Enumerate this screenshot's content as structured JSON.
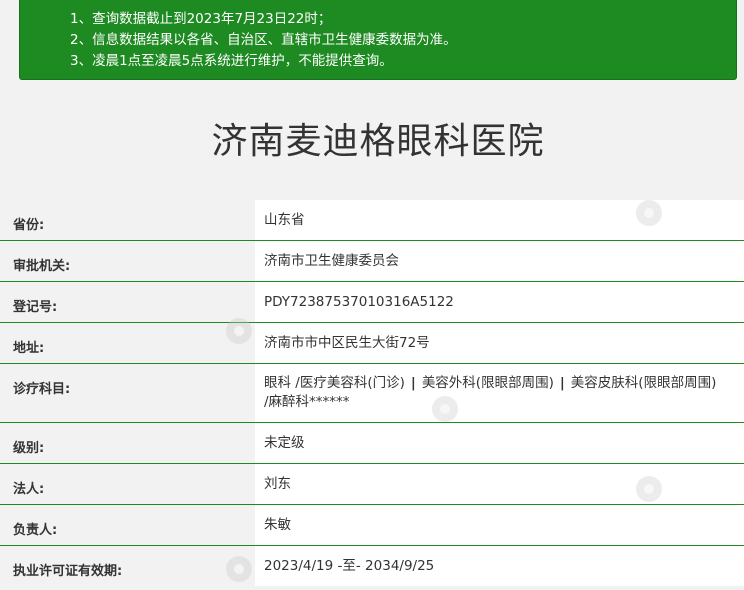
{
  "notice": {
    "lines": [
      "1、查询数据截止到2023年7月23日22时；",
      "2、信息数据结果以各省、自治区、直辖市卫生健康委数据为准。",
      "3、凌晨1点至凌晨5点系统进行维护，不能提供查询。"
    ],
    "background_color": "#1e8a22"
  },
  "title": "济南麦迪格眼科医院",
  "fields": [
    {
      "label": "省份:",
      "value": "山东省"
    },
    {
      "label": "审批机关:",
      "value": "济南市卫生健康委员会"
    },
    {
      "label": "登记号:",
      "value": "PDY72387537010316A5122"
    },
    {
      "label": "地址:",
      "value": "济南市市中区民生大街72号"
    },
    {
      "label": "诊疗科目:",
      "value_parts": [
        "眼科 /医疗美容科(门诊)",
        "|",
        "美容外科(限眼部周围)",
        "|",
        "美容皮肤科(限眼部周围)",
        "/麻醉科******"
      ]
    },
    {
      "label": "级别:",
      "value": "未定级"
    },
    {
      "label": "法人:",
      "value": "刘东"
    },
    {
      "label": "负责人:",
      "value": "朱敏"
    },
    {
      "label": "执业许可证有效期:",
      "value": "2023/4/19 -至- 2034/9/25"
    }
  ],
  "colors": {
    "accent": "#1e8a22",
    "label_bg": "#f2f2f2",
    "value_bg": "#ffffff"
  },
  "icons": {
    "watermark": "watermark-logo-icon"
  }
}
